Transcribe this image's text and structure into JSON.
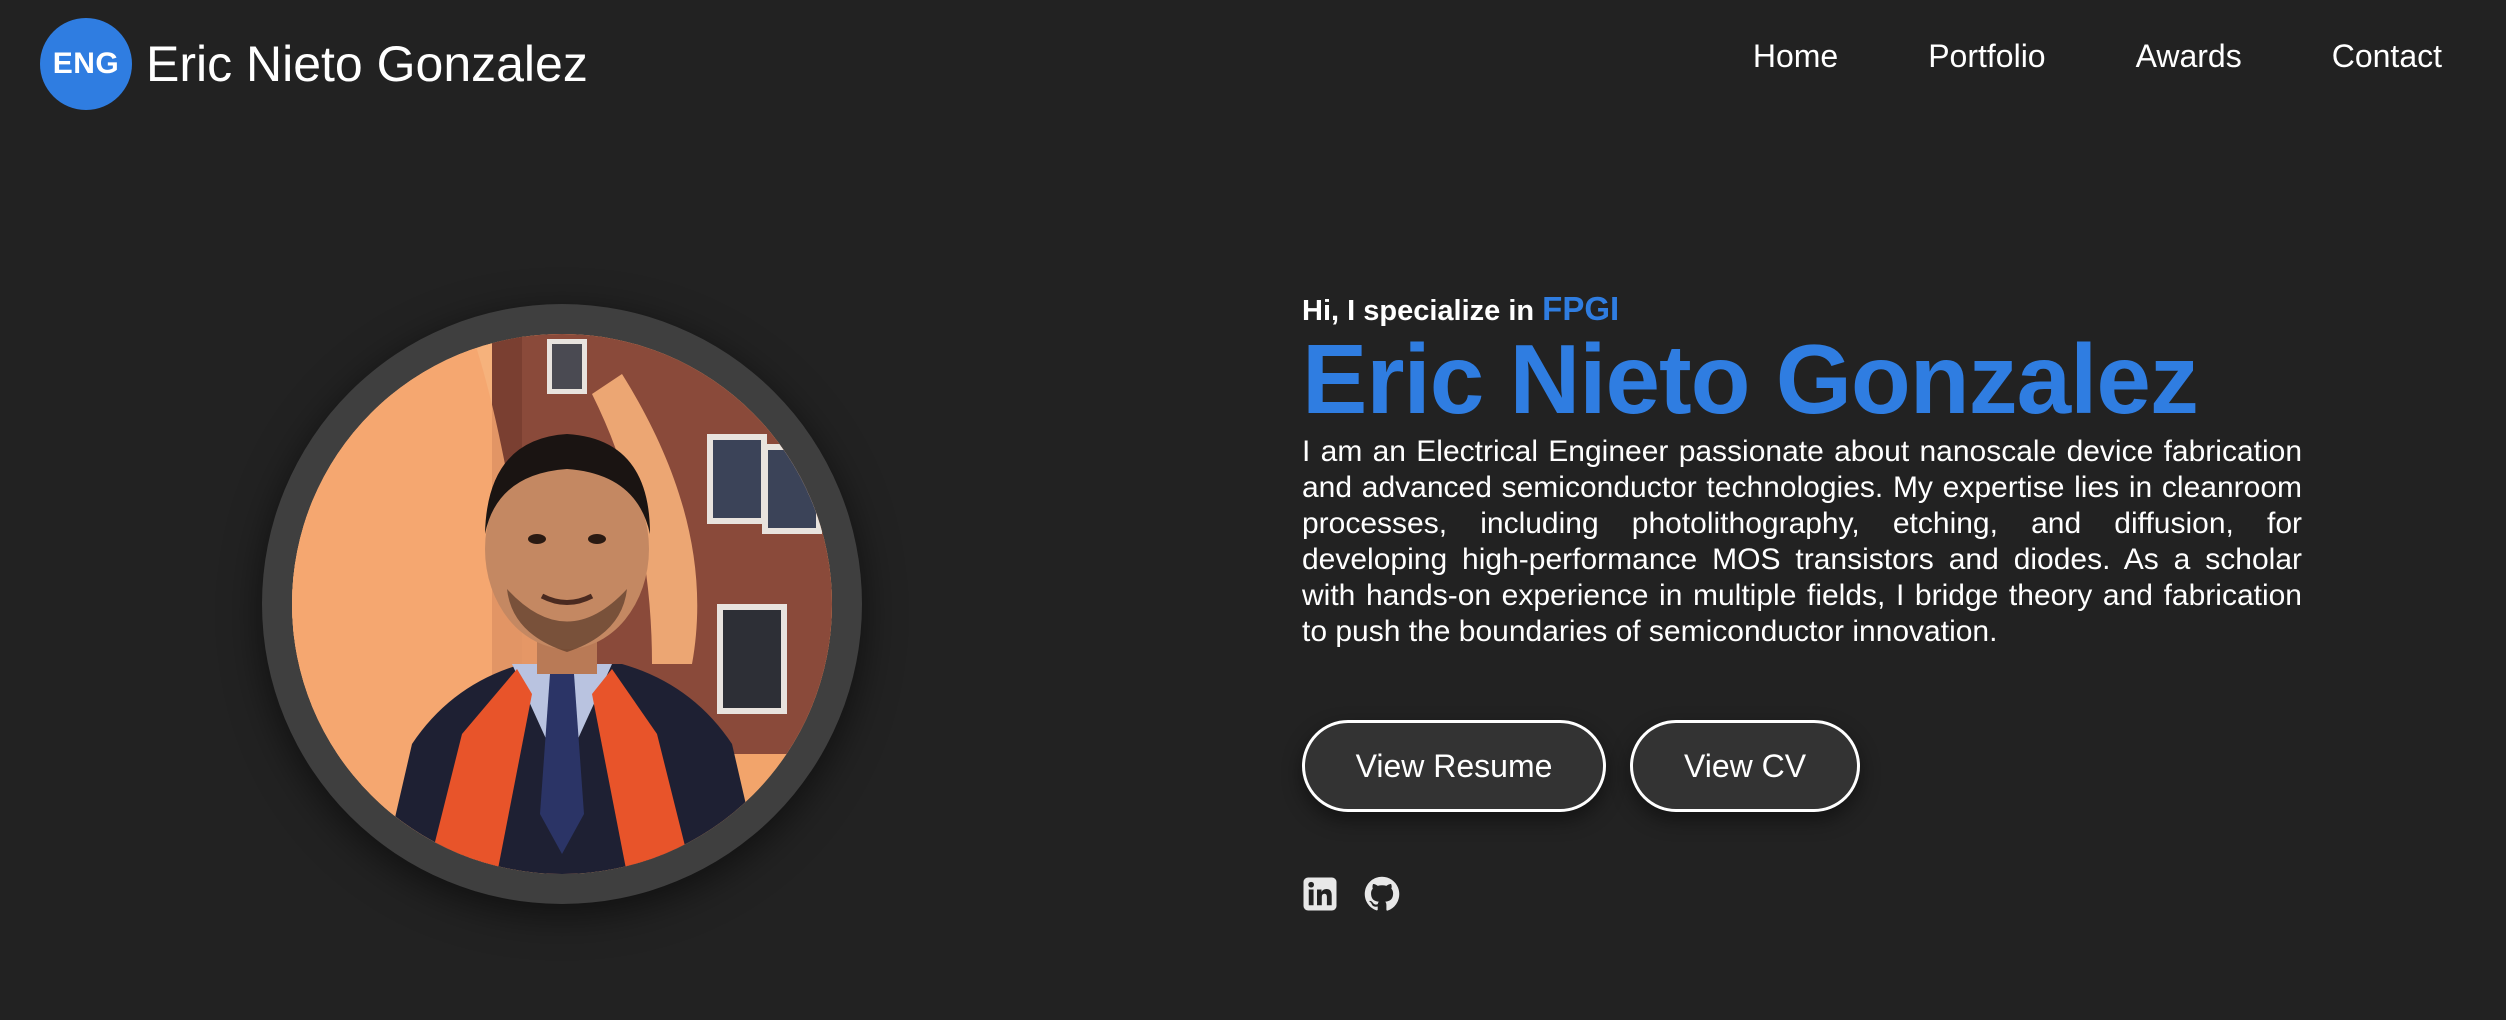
{
  "header": {
    "logo_text": "ENG",
    "brand_name": "Eric Nieto Gonzalez",
    "nav": [
      {
        "label": "Home"
      },
      {
        "label": "Portfolio"
      },
      {
        "label": "Awards"
      },
      {
        "label": "Contact"
      }
    ]
  },
  "hero": {
    "greeting_prefix": "Hi, I specialize in ",
    "specialty": "FPGI",
    "title": "Eric Nieto Gonzalez",
    "bio": "I am an Electrical Engineer passionate about nanoscale device fabrication and advanced semiconductor technologies. My expertise lies in cleanroom processes, including photolithography, etching, and diffusion, for developing high-performance MOS transistors and diodes. As a scholar with hands-on experience in multiple fields, I bridge theory and fabrication to push the boundaries of semiconductor innovation.",
    "buttons": {
      "resume": "View Resume",
      "cv": "View CV"
    },
    "socials": [
      {
        "icon": "linkedin-icon"
      },
      {
        "icon": "github-icon"
      }
    ]
  },
  "colors": {
    "background": "#222222",
    "accent": "#2f7de1",
    "button_bg": "#333333",
    "ring": "#3f3f3f"
  }
}
